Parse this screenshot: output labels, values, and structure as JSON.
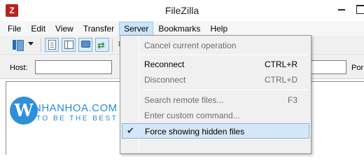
{
  "window": {
    "title": "FileZilla",
    "app_icon_letter": "Z"
  },
  "menubar": [
    {
      "label": "File"
    },
    {
      "label": "Edit"
    },
    {
      "label": "View"
    },
    {
      "label": "Transfer"
    },
    {
      "label": "Server",
      "active": true
    },
    {
      "label": "Bookmarks"
    },
    {
      "label": "Help"
    }
  ],
  "quickconnect": {
    "host_label": "Host:",
    "host_value": "",
    "port_label": "Por"
  },
  "watermark": {
    "letter": "W",
    "name": "NHANHOA.COM",
    "slogan": "TO BE THE BEST"
  },
  "server_menu": {
    "items": [
      {
        "label": "Cancel current operation",
        "shortcut": "",
        "enabled": false,
        "checked": false
      },
      {
        "label": "Reconnect",
        "shortcut": "CTRL+R",
        "enabled": true,
        "checked": false
      },
      {
        "label": "Disconnect",
        "shortcut": "CTRL+D",
        "enabled": false,
        "checked": false
      },
      {
        "label": "Search remote files...",
        "shortcut": "F3",
        "enabled": false,
        "checked": false
      },
      {
        "label": "Enter custom command...",
        "shortcut": "",
        "enabled": false,
        "checked": false
      },
      {
        "label": "Force showing hidden files",
        "shortcut": "",
        "enabled": true,
        "checked": true
      }
    ],
    "check_glyph": "✔"
  },
  "icons": {
    "app": "filezilla-icon",
    "site_manager": "site-manager-icon",
    "message_log": "message-log-toggle-icon",
    "directory_tree": "directory-tree-toggle-icon",
    "remote_tree": "remote-tree-toggle-icon",
    "transfer_queue": "transfer-queue-toggle-icon"
  },
  "colors": {
    "menu_highlight": "#cce4f7",
    "dropdown_highlight": "#d5e6f6",
    "watermark_blue": "#2a8bd6"
  }
}
